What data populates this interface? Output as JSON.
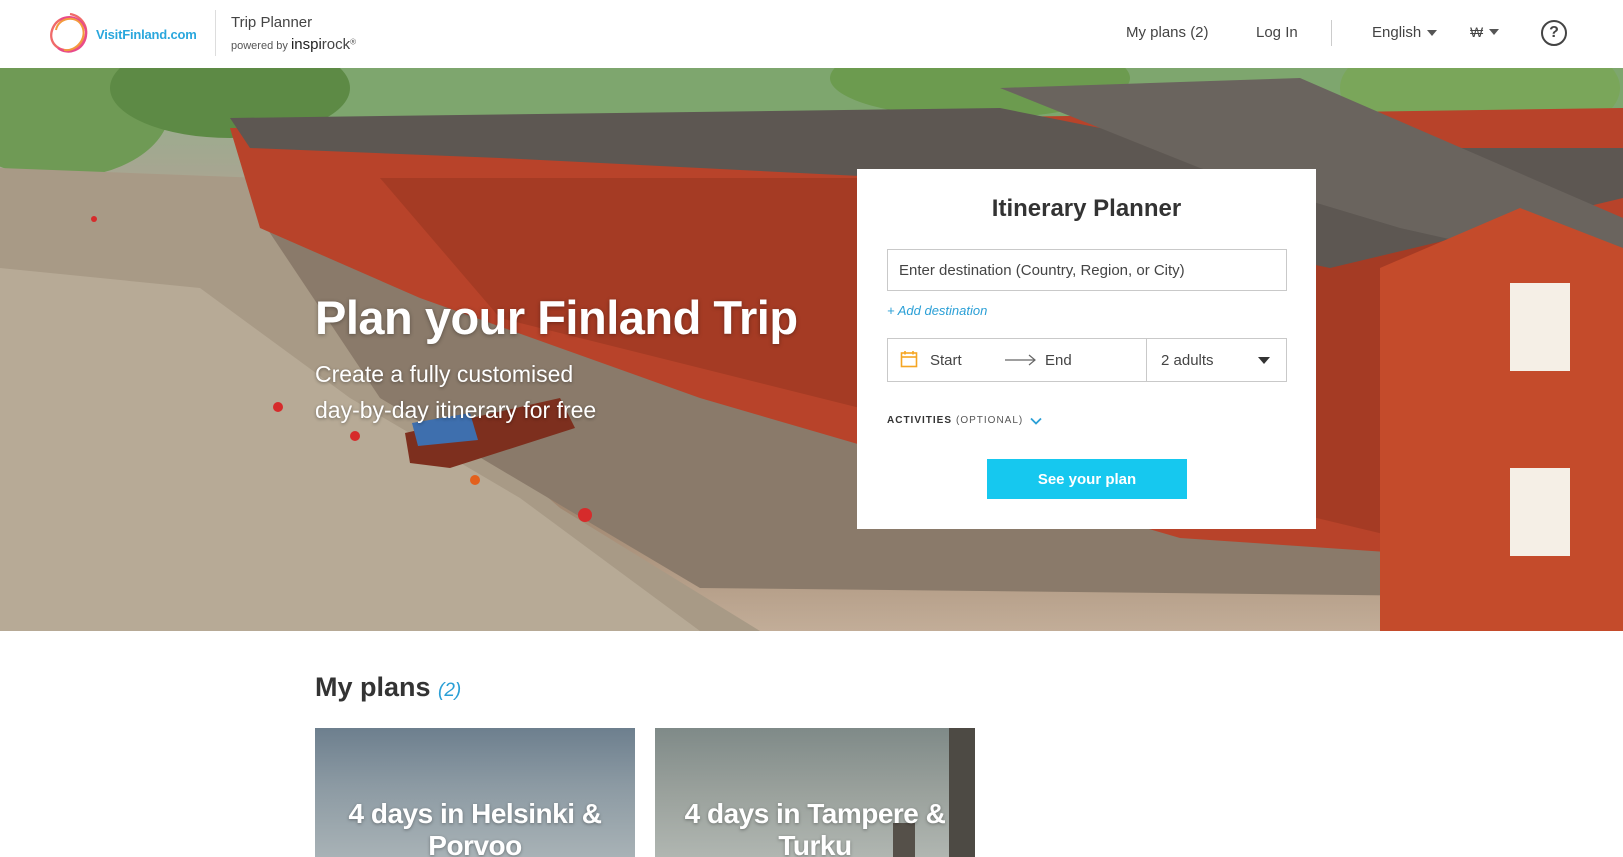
{
  "header": {
    "logo_text": "VisitFinland.com",
    "product_title": "Trip Planner",
    "powered_by": "powered by",
    "brand_strong": "inspi",
    "brand_light": "rock",
    "brand_mark": "®",
    "nav": {
      "my_plans": "My plans (2)",
      "login": "Log In",
      "language": "English",
      "currency": "₩",
      "help": "?"
    }
  },
  "hero": {
    "title": "Plan your Finland Trip",
    "subtitle_line1": "Create a fully customised",
    "subtitle_line2": "day-by-day itinerary for free"
  },
  "planner": {
    "title": "Itinerary Planner",
    "destination_placeholder": "Enter destination (Country, Region, or City)",
    "add_destination": "+ Add destination",
    "start_label": "Start",
    "end_label": "End",
    "guests": "2 adults",
    "activities_label": "ACTIVITIES",
    "activities_optional": "(OPTIONAL)",
    "submit": "See your plan"
  },
  "my_plans": {
    "title": "My plans",
    "count": "(2)",
    "cards": [
      {
        "title_line1": "4 days in Helsinki &",
        "title_line2": "Porvoo"
      },
      {
        "title_line1": "4 days in Tampere &",
        "title_line2": "Turku"
      }
    ]
  },
  "colors": {
    "accent": "#16c8ef",
    "link": "#2a9fd6",
    "calendar_icon": "#f5a623"
  },
  "icons": [
    "visitfinland-logo-icon",
    "caret-down-icon",
    "help-icon",
    "calendar-icon",
    "arrow-right-icon",
    "chevron-down-icon"
  ]
}
